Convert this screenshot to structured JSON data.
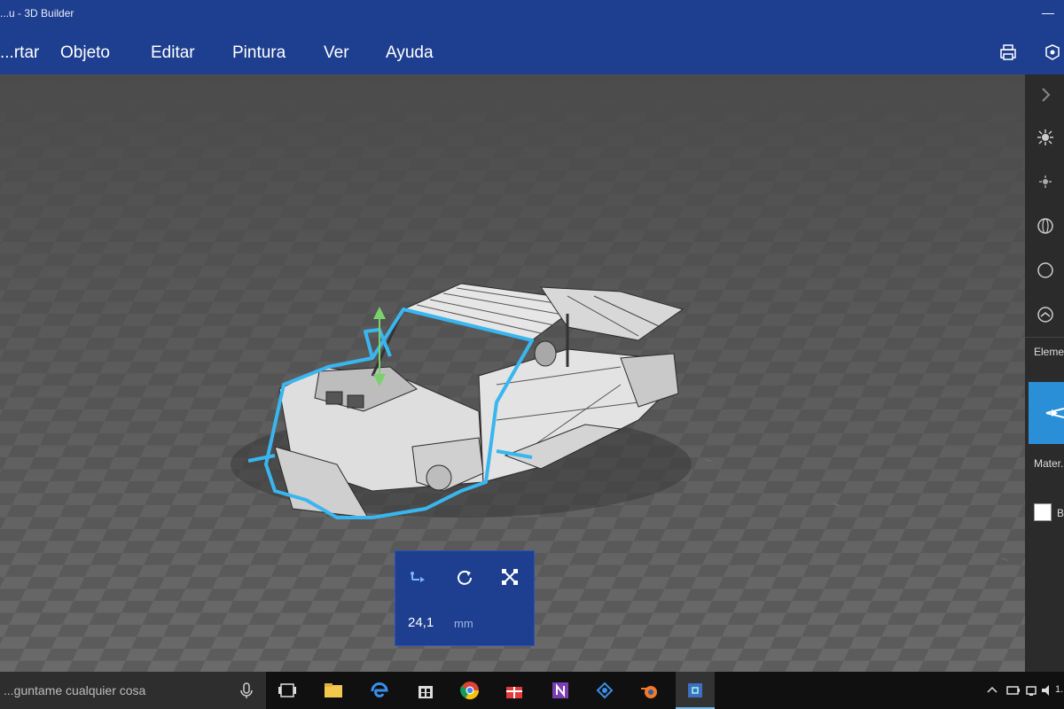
{
  "window": {
    "title": "...u - 3D Builder"
  },
  "menu": {
    "items": [
      "...rtar",
      "Objeto",
      "Editar",
      "Pintura",
      "Ver",
      "Ayuda"
    ],
    "right_icons": [
      "print-icon",
      "share-icon"
    ]
  },
  "viewport": {
    "object": "car-wireframe-model",
    "selection_color": "#39b6f0",
    "ruler_labels": [
      "...",
      "...",
      "..."
    ]
  },
  "transform_panel": {
    "tools": [
      "move-icon",
      "rotate-icon",
      "scale-icon"
    ],
    "value": "24,1",
    "unit": "mm"
  },
  "side_panel": {
    "icons": [
      "collapse-chevron-icon",
      "light-icon",
      "light-dim-icon",
      "sphere-icon",
      "circle-icon",
      "layer-icon"
    ],
    "elements_label": "Eleme...",
    "material_label": "Mater...",
    "material_swatch_label": "B...",
    "active_color": "#2a8fd6"
  },
  "taskbar": {
    "search_placeholder": "...guntame cualquier cosa",
    "apps": [
      "task-view-icon",
      "file-explorer-icon",
      "edge-icon",
      "store-icon",
      "chrome-icon",
      "gift-icon",
      "onenote-icon",
      "network-icon",
      "blender-icon",
      "3d-builder-icon"
    ],
    "clock": "1..."
  },
  "colors": {
    "titlebar": "#1e3f8f",
    "accent": "#2a8fd6"
  }
}
